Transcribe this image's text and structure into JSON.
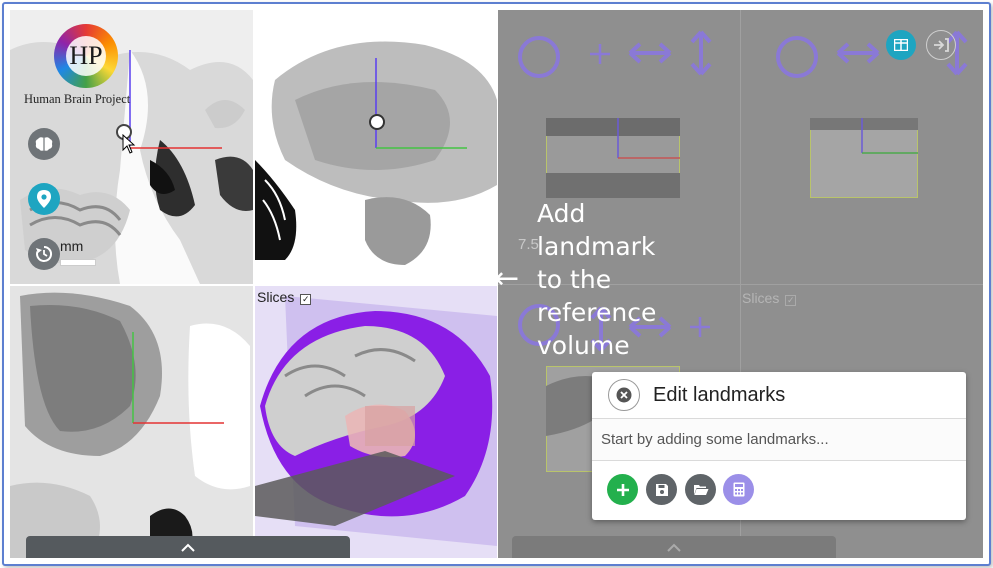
{
  "logo": {
    "initials": "HP",
    "text": "Human Brain Project"
  },
  "scale_bar": {
    "label": "mm"
  },
  "slices_label": "Slices",
  "right_slices_label": "Slices",
  "ref_value_label": "7.5",
  "annotation": {
    "arrow": "←",
    "line1": "Add",
    "line2": "landmark",
    "line3": "to the",
    "line4": "reference",
    "line5": "volume"
  },
  "dialog": {
    "title": "Edit landmarks",
    "placeholder": "Start by adding some landmarks..."
  },
  "colors": {
    "teal": "#1ea5c1",
    "add_green": "#23b04d",
    "dark_grey": "#5f6468",
    "lavender": "#9b8fe8",
    "purple_icons": "#8a79d6",
    "brain_purple": "#8a1fe6",
    "frame_blue": "#5d7fd0"
  },
  "icons": [
    "brain-icon",
    "pin-icon",
    "history-icon",
    "close-icon",
    "add-icon",
    "save-icon",
    "folder-open-icon",
    "calculator-icon",
    "layout-icon",
    "exit-icon",
    "chevron-up-icon"
  ]
}
